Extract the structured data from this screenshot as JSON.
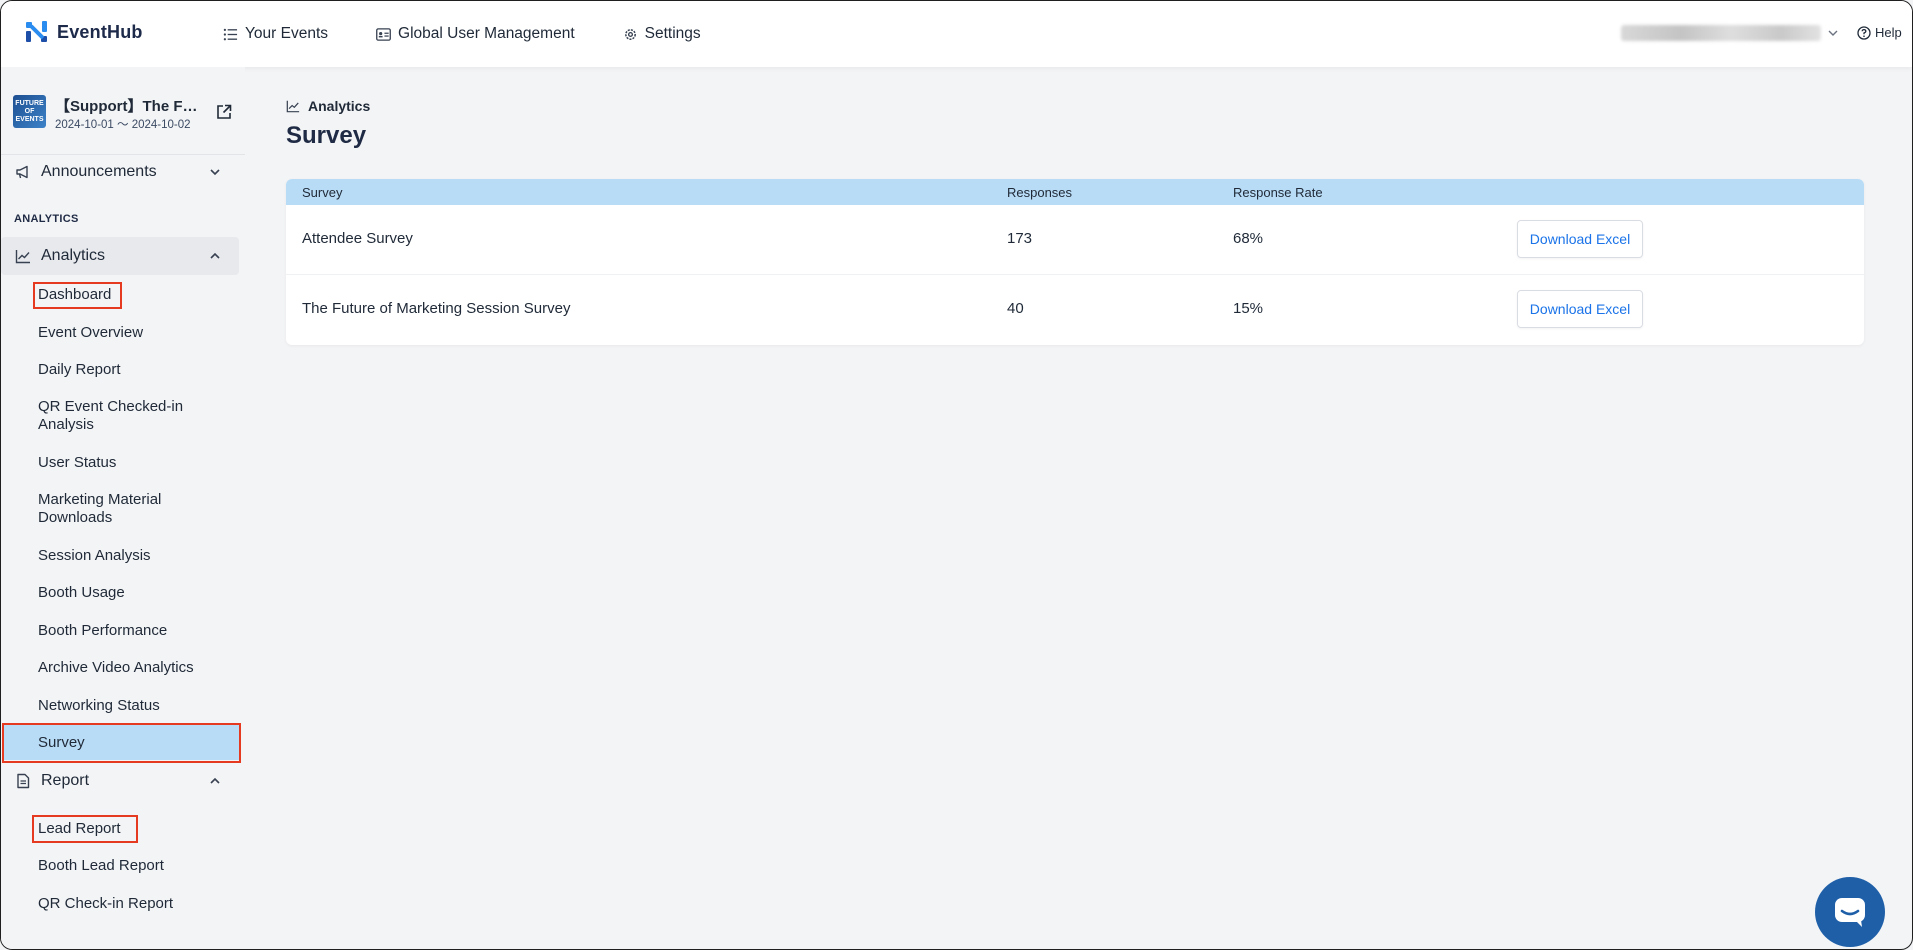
{
  "app": {
    "name": "EventHub"
  },
  "topnav": {
    "your_events": "Your Events",
    "global_user_management": "Global User Management",
    "settings": "Settings",
    "help": "Help"
  },
  "event": {
    "title": "【Support】The F…",
    "dates": "2024-10-01 〜 2024-10-02",
    "thumb_text": "FUTURE OF EVENTS"
  },
  "sidebar": {
    "announcements": "Announcements",
    "section_label": "ANALYTICS",
    "analytics": "Analytics",
    "analytics_items": [
      "Dashboard",
      "Event Overview",
      "Daily Report",
      "QR Event Checked-in Analysis",
      "User Status",
      "Marketing Material Downloads",
      "Session Analysis",
      "Booth Usage",
      "Booth Performance",
      "Archive Video Analytics",
      "Networking Status",
      "Survey"
    ],
    "report": "Report",
    "report_items": [
      "Lead Report",
      "Booth Lead Report",
      "QR Check-in Report"
    ]
  },
  "main": {
    "breadcrumb": "Analytics",
    "title": "Survey",
    "table": {
      "headers": [
        "Survey",
        "Responses",
        "Response Rate"
      ],
      "rows": [
        {
          "survey": "Attendee Survey",
          "responses": "173",
          "rate": "68%",
          "action": "Download Excel"
        },
        {
          "survey": "The Future of Marketing Session Survey",
          "responses": "40",
          "rate": "15%",
          "action": "Download Excel"
        }
      ]
    }
  },
  "colors": {
    "accent": "#1a73e8",
    "header_bg": "#b9dcf6",
    "highlight": "#e53a1f",
    "chat": "#1e5fa8"
  }
}
